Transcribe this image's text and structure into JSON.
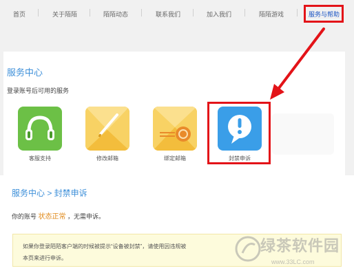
{
  "nav": {
    "items": [
      "首页",
      "关于陌陌",
      "陌陌动态",
      "联系我们",
      "加入我们",
      "陌陌游戏"
    ],
    "active": "服务与帮助"
  },
  "service_center": {
    "title": "服务中心",
    "subtitle": "登录账号后可用的服务",
    "services": [
      {
        "label": "客服支持",
        "icon": "headset-icon"
      },
      {
        "label": "修改邮箱",
        "icon": "envelope-pencil-icon"
      },
      {
        "label": "绑定邮箱",
        "icon": "envelope-seal-icon"
      },
      {
        "label": "封禁申诉",
        "icon": "speech-bubble-exclamation-icon"
      }
    ]
  },
  "appeal": {
    "breadcrumb": "服务中心 > 封禁申诉",
    "status_prefix": "你的账号",
    "status_value": "状态正常",
    "status_suffix": "，无需申诉。",
    "notice_line1": "如果你登录陌陌客户端的时候被提示“设备被封禁”，请使用因违规被",
    "notice_line2": "本页来进行申诉。"
  },
  "watermark": {
    "brand": "绿茶软件园",
    "url": "www.33LC.com"
  },
  "colors": {
    "highlight_red": "#e31318",
    "link_blue": "#3d8fd9",
    "active_nav": "#1a55c4",
    "status_orange": "#e08a1a",
    "notice_bg": "#fdfbdc"
  }
}
